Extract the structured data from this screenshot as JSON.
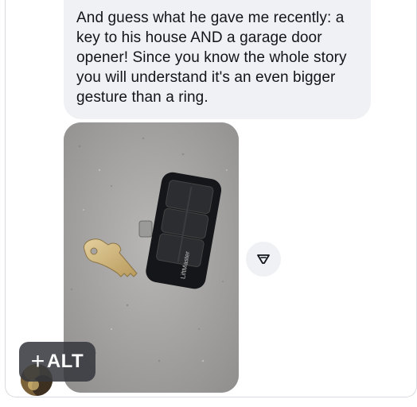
{
  "message": {
    "text": "And guess what he gave me recently: a key to his house AND a garage door opener! Since you know the whole story you will understand it's an even bigger gesture than a ring."
  },
  "photo": {
    "remote_brand": "LiftMaster"
  },
  "react_button": {
    "icon": "react-icon"
  },
  "alt_badge": {
    "plus": "+",
    "label": "ALT"
  },
  "avatar": {
    "icon": "user-avatar"
  }
}
